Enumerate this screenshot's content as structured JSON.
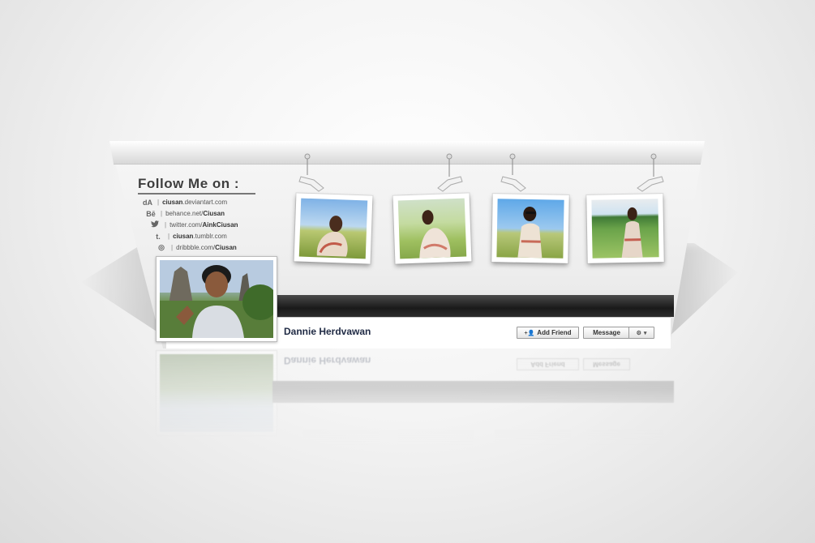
{
  "follow": {
    "title": "Follow Me on :",
    "links": [
      {
        "icon": "deviantart-icon",
        "glyph": "dA",
        "prefix": "",
        "bold": "ciusan",
        "suffix": ".deviantart.com"
      },
      {
        "icon": "behance-icon",
        "glyph": "Bē",
        "prefix": "behance.net/",
        "bold": "Ciusan",
        "suffix": ""
      },
      {
        "icon": "twitter-icon",
        "glyph": "🐦",
        "prefix": "twitter.com/",
        "bold": "AinkCiusan",
        "suffix": ""
      },
      {
        "icon": "tumblr-icon",
        "glyph": "t.",
        "prefix": "",
        "bold": "ciusan",
        "suffix": ".tumblr.com"
      },
      {
        "icon": "dribbble-icon",
        "glyph": "◎",
        "prefix": "dribbble.com/",
        "bold": "Ciusan",
        "suffix": ""
      }
    ]
  },
  "profile": {
    "name": "Dannie Herdvawan",
    "add_friend_label": "Add Friend",
    "message_label": "Message"
  },
  "colors": {
    "name_color": "#1f2a44",
    "band_dark": "#1a1a1a"
  }
}
